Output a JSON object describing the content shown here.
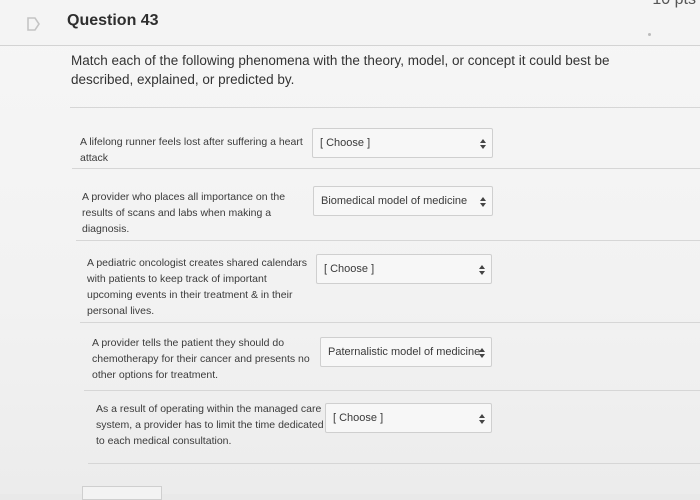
{
  "header": {
    "question_title": "Question 43",
    "points_partial": "10 pts"
  },
  "prompt": "Match each of the following phenomena with the theory, model, or concept it could best be described, explained, or predicted by.",
  "items": [
    {
      "statement": "A lifelong runner feels lost after suffering a heart attack",
      "selected": "[ Choose ]"
    },
    {
      "statement": "A provider who places all importance on the results of scans and labs when making a diagnosis.",
      "selected": "Biomedical model of medicine"
    },
    {
      "statement": "A pediatric oncologist creates shared calendars with patients to keep track of important upcoming events in their treatment & in their personal lives.",
      "selected": "[ Choose ]"
    },
    {
      "statement": "A provider tells the patient they should do chemotherapy for their cancer and presents no other options for treatment.",
      "selected": "Paternalistic model of medicine"
    },
    {
      "statement": "As a result of operating within the managed care system, a provider has to limit the time dedicated to each medical consultation.",
      "selected": "[ Choose ]"
    }
  ],
  "colors": {
    "background": "#f4f4f4",
    "flag_icon": "#c9c9c9",
    "select_border": "#cfcfcf",
    "text": "#2d2d2d"
  },
  "icons": [
    "flag-icon",
    "chevron-updown-icon"
  ]
}
